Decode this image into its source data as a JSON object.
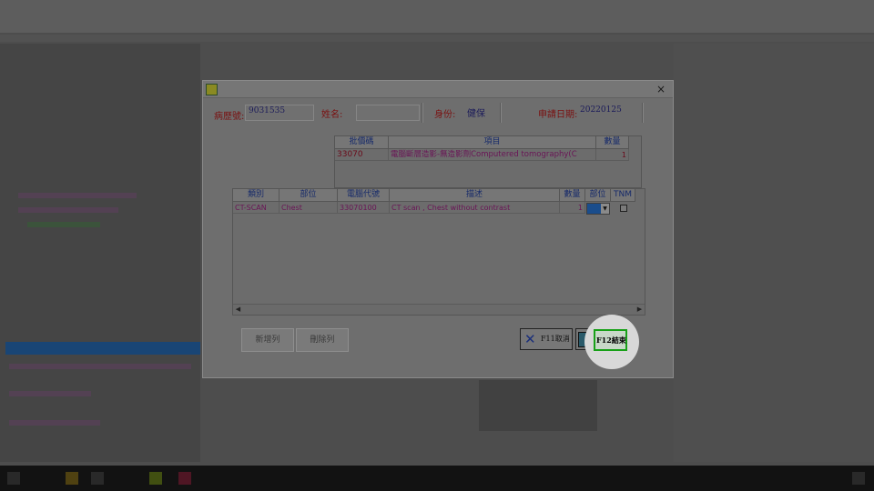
{
  "dialog": {
    "close_glyph": "×"
  },
  "header": {
    "chart_no_label": "病歷號:",
    "chart_no_value": "9031535",
    "name_label": "姓名:",
    "identity_label": "身份:",
    "identity_value": "健保",
    "apply_date_label": "申請日期:",
    "apply_date_value": "20220125"
  },
  "upper_table": {
    "columns": [
      "批價碼",
      "項目",
      "數量"
    ],
    "row": {
      "code": "33070",
      "item": "電腦斷層造影-無造影劑Computered tomography(C",
      "qty": "1"
    }
  },
  "lower_table": {
    "columns": [
      "類別",
      "部位",
      "電腦代號",
      "描述",
      "數量",
      "部位",
      "TNM"
    ],
    "row": {
      "category": "CT-SCAN",
      "site": "Chest",
      "code": "33070100",
      "desc": "CT scan , Chest without contrast",
      "qty": "1"
    }
  },
  "buttons": {
    "add_row": "新增列",
    "delete_row": "刪除列",
    "f11_cancel": "F11取消",
    "f12_finish": "F12結束"
  },
  "colors": {
    "selected_blue": "#1a4d8c",
    "highlight_green": "#18a018"
  }
}
